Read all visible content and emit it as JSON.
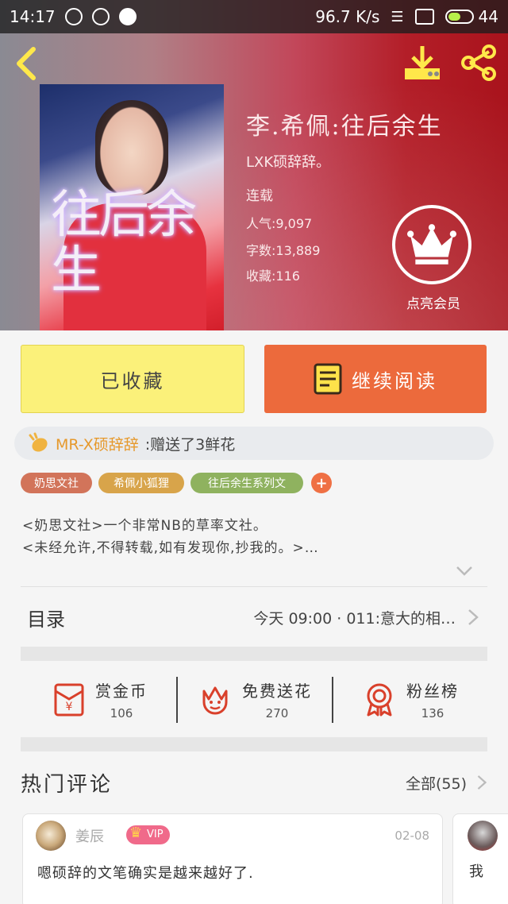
{
  "status_bar": {
    "time": "14:17",
    "speed": "96.7 K/s",
    "battery": "44"
  },
  "book": {
    "title": "李.希佩:往后余生",
    "author": "LXK硕辞辞。",
    "status": "连载",
    "popularity": "人气:9,097",
    "word_count": "字数:13,889",
    "favorites": "收藏:116",
    "cover_text": "往后余生"
  },
  "vip": {
    "label": "点亮会员"
  },
  "buttons": {
    "collected": "已收藏",
    "continue_reading": "继续阅读"
  },
  "gift": {
    "sender": "MR-X硕辞辞",
    "message": ":赠送了3鲜花"
  },
  "tags": [
    "奶思文社",
    "希佩小狐狸",
    "往后余生系列文",
    "+"
  ],
  "intro": [
    "<奶思文社>一个非常NB的草率文社。",
    "<未经允许,不得转载,如有发现你,抄我的。>…"
  ],
  "toc": {
    "label": "目录",
    "latest": "今天 09:00 · 011:意大的相…"
  },
  "stats": [
    {
      "label": "赏金币",
      "count": "106"
    },
    {
      "label": "免费送花",
      "count": "270"
    },
    {
      "label": "粉丝榜",
      "count": "136"
    }
  ],
  "comments_section": {
    "title": "热门评论",
    "all_label": "全部(55)"
  },
  "comments": [
    {
      "name": "姜辰",
      "vip": "VIP",
      "date": "02-08",
      "body": "嗯硕辞的文笔确实是越来越好了."
    },
    {
      "body": "我"
    }
  ],
  "colors": {
    "accent_orange": "#ec6a3c",
    "collected_yellow": "#fbf17a",
    "gift_sender": "#e6992c"
  }
}
